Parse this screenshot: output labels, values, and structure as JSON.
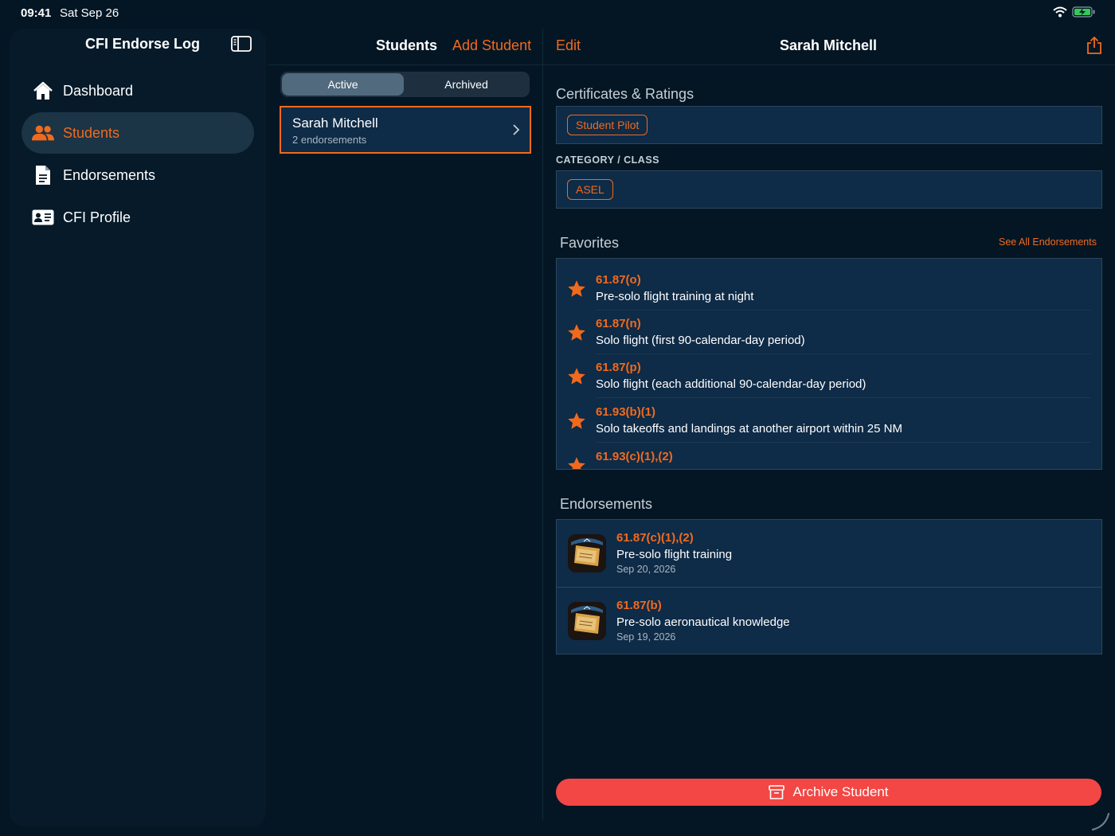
{
  "status": {
    "time": "09:41",
    "date": "Sat Sep 26"
  },
  "colors": {
    "accent": "#f06a1e",
    "background": "#041624",
    "panel": "#0e2b47",
    "danger": "#f24744"
  },
  "sidebar": {
    "title": "CFI Endorse Log",
    "toggle_icon": "sidebar-toggle-icon",
    "items": [
      {
        "label": "Dashboard",
        "icon": "house-icon",
        "active": false
      },
      {
        "label": "Students",
        "icon": "people-icon",
        "active": true
      },
      {
        "label": "Endorsements",
        "icon": "document-icon",
        "active": false
      },
      {
        "label": "CFI Profile",
        "icon": "id-card-icon",
        "active": false
      }
    ]
  },
  "students": {
    "title": "Students",
    "add_label": "Add Student",
    "segments": [
      "Active",
      "Archived"
    ],
    "selected_segment": "Active",
    "list": [
      {
        "name": "Sarah Mitchell",
        "subtitle": "2 endorsements"
      }
    ]
  },
  "detail": {
    "edit_label": "Edit",
    "title": "Sarah Mitchell",
    "share_icon": "share-icon",
    "certificates_head": "Certificates & Ratings",
    "certificates": [
      "Student Pilot"
    ],
    "category_head": "CATEGORY / CLASS",
    "categories": [
      "ASEL"
    ],
    "favorites_head": "Favorites",
    "see_all_label": "See All Endorsements",
    "favorites": [
      {
        "code": "61.87(o)",
        "desc": "Pre-solo flight training at night"
      },
      {
        "code": "61.87(n)",
        "desc": "Solo flight (first 90-calendar-day period)"
      },
      {
        "code": "61.87(p)",
        "desc": "Solo flight (each additional 90-calendar-day period)"
      },
      {
        "code": "61.93(b)(1)",
        "desc": "Solo takeoffs and landings at another airport within 25 NM"
      },
      {
        "code": "61.93(c)(1),(2)",
        "desc": ""
      }
    ],
    "endorsements_head": "Endorsements",
    "endorsements": [
      {
        "code": "61.87(c)(1),(2)",
        "desc": "Pre-solo flight training",
        "date": "Sep 20, 2026"
      },
      {
        "code": "61.87(b)",
        "desc": "Pre-solo aeronautical knowledge",
        "date": "Sep 19, 2026"
      }
    ],
    "archive_label": "Archive Student"
  }
}
